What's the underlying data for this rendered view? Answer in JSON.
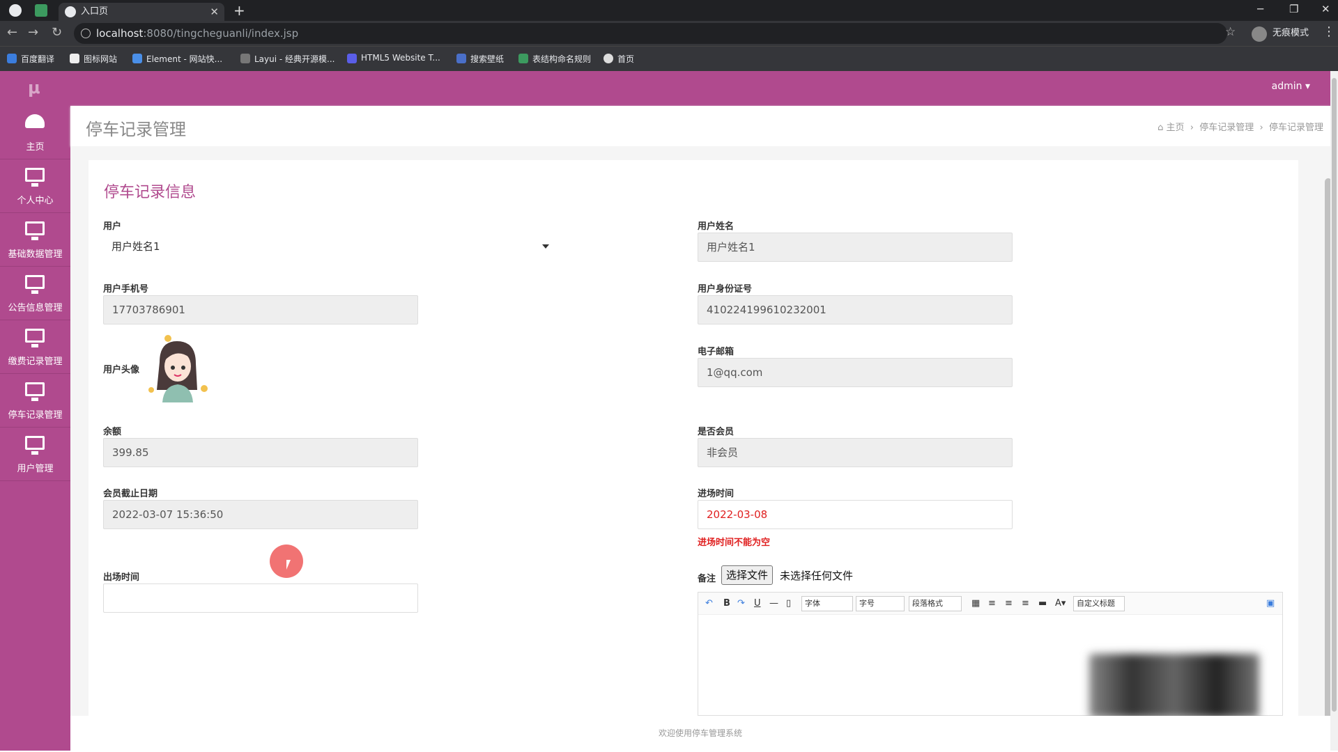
{
  "browser": {
    "tab_title": "入口页",
    "url_host": "localhost",
    "url_path": ":8080/tingcheguanli/index.jsp",
    "incognito_label": "无痕模式",
    "bookmarks": [
      "百度翻译",
      "图标网站",
      "Element - 网站快...",
      "Layui - 经典开源模...",
      "HTML5 Website T...",
      "搜索壁纸",
      "表结构命名规则",
      "首页"
    ]
  },
  "topbar": {
    "user": "admin ▾"
  },
  "sidebar": {
    "items": [
      "主页",
      "个人中心",
      "基础数据管理",
      "公告信息管理",
      "缴费记录管理",
      "停车记录管理",
      "用户管理"
    ]
  },
  "header": {
    "title": "停车记录管理",
    "breadcrumb": [
      "主页",
      "停车记录管理",
      "停车记录管理"
    ]
  },
  "form": {
    "title": "停车记录信息",
    "user_label": "用户",
    "user_value": "用户姓名1",
    "name_label": "用户姓名",
    "name_value": "用户姓名1",
    "phone_label": "用户手机号",
    "phone_value": "17703786901",
    "idcard_label": "用户身份证号",
    "idcard_value": "410224199610232001",
    "avatar_label": "用户头像",
    "email_label": "电子邮箱",
    "email_value": "1@qq.com",
    "balance_label": "余额",
    "balance_value": "399.85",
    "member_label": "是否会员",
    "member_value": "非会员",
    "member_end_label": "会员截止日期",
    "member_end_value": "2022-03-07 15:36:50",
    "entry_label": "进场时间",
    "entry_value": "2022-03-08",
    "entry_error": "进场时间不能为空",
    "exit_label": "出场时间",
    "exit_value": "",
    "remark_label": "备注",
    "file_button": "选择文件",
    "file_text": "未选择任何文件"
  },
  "editor": {
    "font": "字体",
    "size": "字号",
    "paragraph": "段落格式",
    "custom": "自定义标题"
  },
  "footer": {
    "text": "欢迎使用停车管理系统"
  },
  "colors": {
    "brand": "#b04a8e",
    "error": "#e02020"
  }
}
